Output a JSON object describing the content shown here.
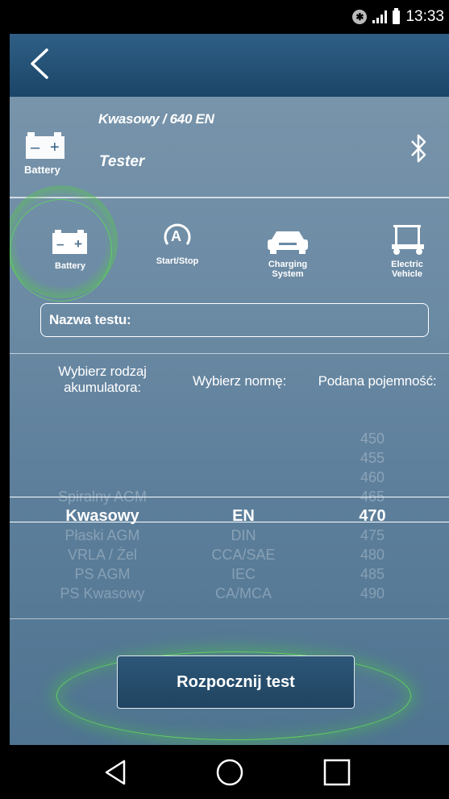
{
  "status_bar": {
    "time": "13:33",
    "bluetooth_glyph": "✱"
  },
  "header": {
    "subtitle": "Kwasowy / 640 EN",
    "title": "Tester",
    "battery_label": "Battery",
    "battery_glyph": "− +"
  },
  "modes": [
    {
      "label": "Battery",
      "icon": "battery-icon"
    },
    {
      "label": "Start/Stop",
      "icon": "start-stop-icon"
    },
    {
      "label_line1": "Charging",
      "label_line2": "System",
      "icon": "car-icon"
    },
    {
      "label_line1": "Electric",
      "label_line2": "Vehicle",
      "icon": "golf-cart-icon"
    }
  ],
  "mode_battery_glyph": "− +",
  "mode_start_glyph": "A",
  "test_name": {
    "label": "Nazwa testu:"
  },
  "columns": {
    "battery_type_line1": "Wybierz rodzaj",
    "battery_type_line2": "akumulatora:",
    "norm": "Wybierz normę:",
    "capacity": "Podana pojemność:"
  },
  "picker": {
    "battery_types": [
      "Spiralny AGM",
      "Kwasowy",
      "Płaski AGM",
      "VRLA / Żel",
      "PS AGM",
      "PS Kwasowy"
    ],
    "battery_selected_index": 1,
    "norms": [
      "EN",
      "DIN",
      "CCA/SAE",
      "IEC",
      "CA/MCA"
    ],
    "norm_selected_index": 0,
    "capacities": [
      "450",
      "455",
      "460",
      "465",
      "470",
      "475",
      "480",
      "485",
      "490"
    ],
    "capacity_selected_index": 4
  },
  "start_button": {
    "label": "Rozpocznij test"
  },
  "colors": {
    "accent_glow": "#61cf5e",
    "topbar": "#1b4567",
    "panel": "#6a89a3"
  }
}
